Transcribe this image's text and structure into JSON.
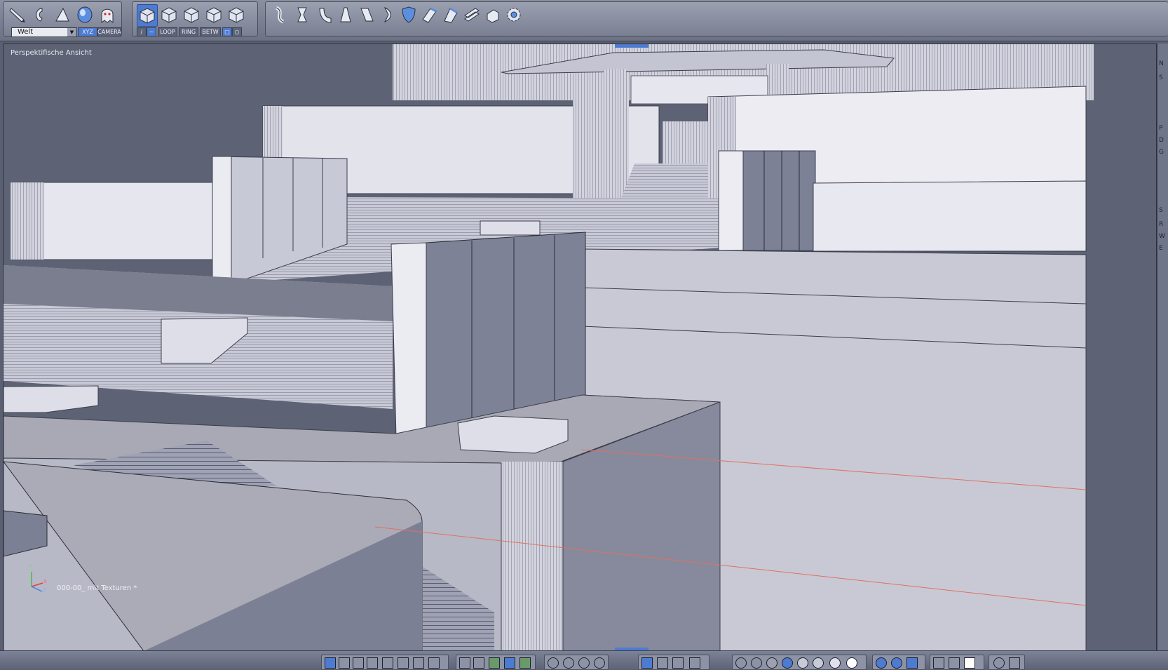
{
  "toolbar": {
    "coordinate_system": "Welt",
    "toggle_xyz": "XYZ",
    "toggle_camera": "CAMERA",
    "mode_loop": "LOOP",
    "mode_ring": "RING",
    "mode_betw": "BETW"
  },
  "viewport": {
    "title": "Perspektifische Ansicht",
    "scene_name": "000-00_ mit Texturen *",
    "axis_x": "X",
    "axis_y": "Y",
    "axis_z": "Z"
  },
  "right_panel": {
    "letters": [
      "N",
      "S",
      "P",
      "D",
      "G",
      "S",
      "R",
      "W",
      "E"
    ]
  },
  "colors": {
    "accent": "#4d7bd0",
    "toolbar_bg": "#7a8092",
    "viewport_bg": "#5d6274",
    "model_light": "#e6e6ee",
    "model_mid": "#b6b8c8",
    "model_dark": "#7c8094",
    "guide_line": "#e07060"
  },
  "icons": {
    "brush_tools": [
      "pencil-icon",
      "hook-icon",
      "knife-icon",
      "sphere-icon",
      "ghost-icon"
    ],
    "selection_cubes": [
      "cube-vertex-icon",
      "cube-edge-icon",
      "cube-face-icon",
      "cube-poly-icon",
      "cube-object-icon"
    ],
    "deform_tools": [
      "twist-icon",
      "pinch-icon",
      "bend-icon",
      "taper-icon",
      "shear-icon",
      "bulge-icon",
      "shield-icon",
      "extrude-icon",
      "flatten-icon",
      "stack-icon",
      "hand-icon",
      "gear-icon"
    ]
  }
}
